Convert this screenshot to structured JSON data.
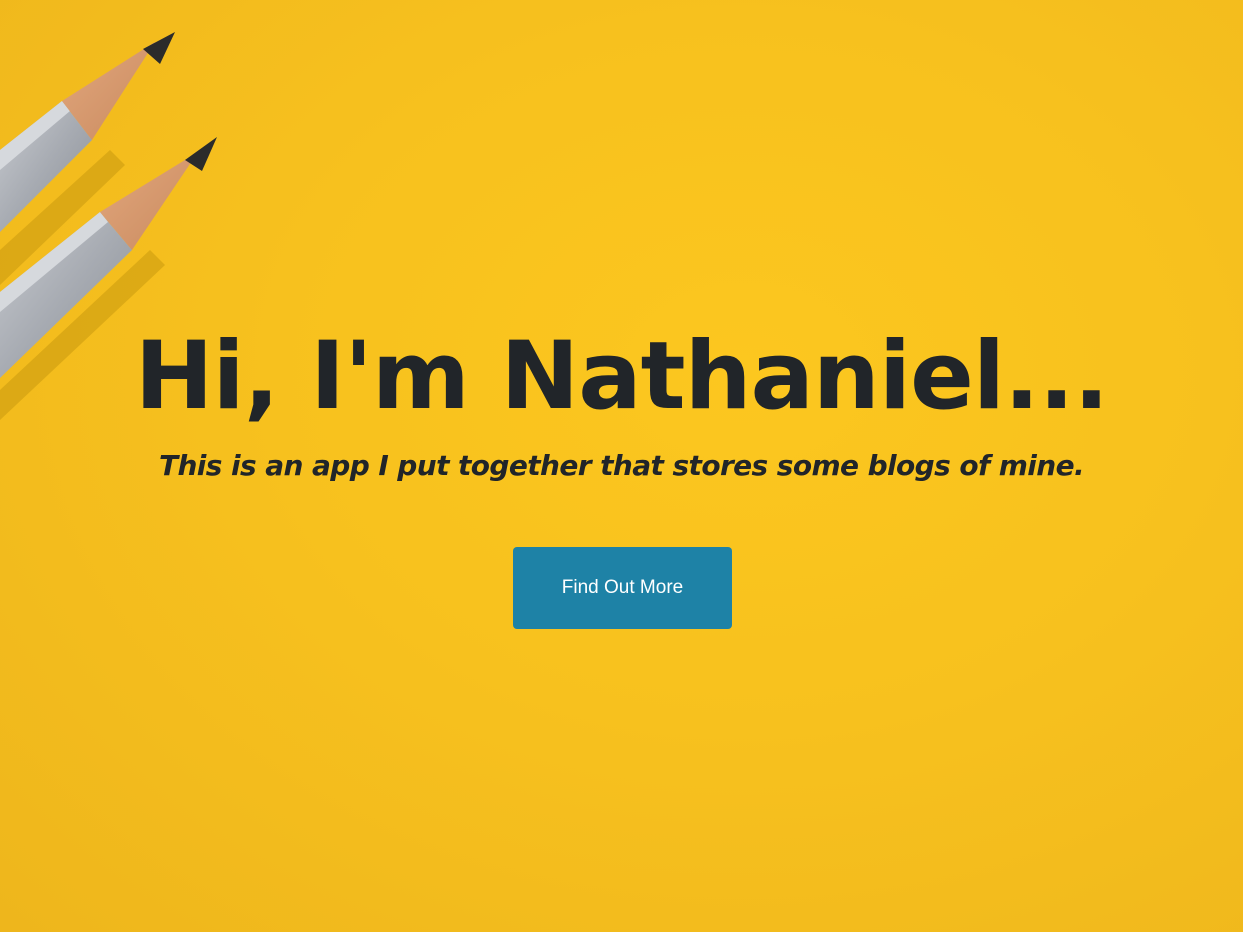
{
  "hero": {
    "heading": "Hi, I'm Nathaniel...",
    "subheading": "This is an app I put together that stores some blogs of mine.",
    "cta_label": "Find Out More",
    "background_color": "#f7c11e",
    "button_color": "#1e82a6",
    "decoration": "pencils-image"
  }
}
